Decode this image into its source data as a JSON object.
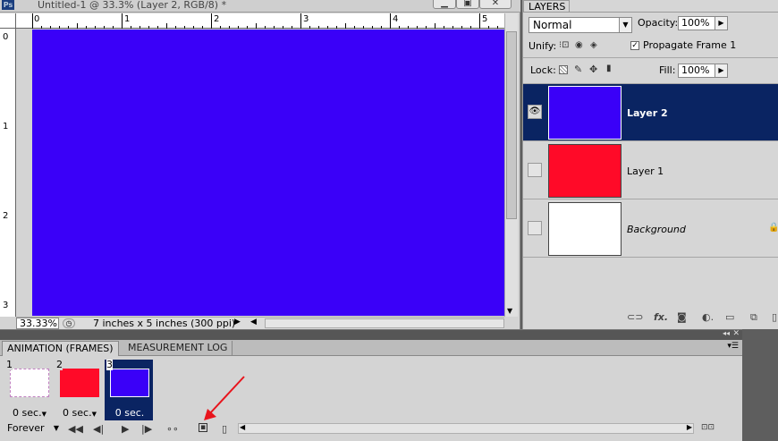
{
  "document": {
    "title": "Untitled-1 @ 33.3% (Layer 2, RGB/8) *",
    "app_icon": "Ps",
    "window_buttons": [
      "minimize-icon",
      "restore-icon",
      "close-icon"
    ],
    "ruler_h_labels": [
      "0",
      "1",
      "2",
      "3",
      "4",
      "5"
    ],
    "ruler_v_labels": [
      "0",
      "1",
      "2",
      "3"
    ],
    "canvas_color": "#3a00f8",
    "zoom": "33.33%",
    "doc_info": "7 inches x 5 inches (300 ppi)"
  },
  "layers_panel": {
    "tab_label": "LAYERS",
    "blend_mode": "Normal",
    "opacity_label": "Opacity:",
    "opacity_value": "100%",
    "unify_label": "Unify:",
    "propagate_label": "Propagate Frame 1",
    "propagate_checked": true,
    "lock_label": "Lock:",
    "fill_label": "Fill:",
    "fill_value": "100%",
    "layers": [
      {
        "name": "Layer 2",
        "color": "#3a00f8",
        "visible": true,
        "selected": true,
        "italic": false
      },
      {
        "name": "Layer 1",
        "color": "#ff0a28",
        "visible": false,
        "selected": false,
        "italic": false
      },
      {
        "name": "Background",
        "color": "#ffffff",
        "visible": false,
        "selected": false,
        "italic": true,
        "locked": true
      }
    ],
    "footer_icons": [
      "link-icon",
      "fx-icon",
      "mask-icon",
      "adjustment-icon",
      "group-icon",
      "new-layer-icon",
      "trash-icon"
    ]
  },
  "animation_panel": {
    "tabs": [
      "ANIMATION (FRAMES)",
      "MEASUREMENT LOG"
    ],
    "active_tab": 0,
    "frames": [
      {
        "number": "1",
        "delay": "0 sec.",
        "color": "#ffffff",
        "selected": false
      },
      {
        "number": "2",
        "delay": "0 sec.",
        "color": "#ff0a28",
        "selected": false
      },
      {
        "number": "3",
        "delay": "0 sec.",
        "color": "#3a00f8",
        "selected": true
      }
    ],
    "loop": "Forever",
    "selection_color": "#0a2462",
    "arrow_color": "#e8141c"
  }
}
